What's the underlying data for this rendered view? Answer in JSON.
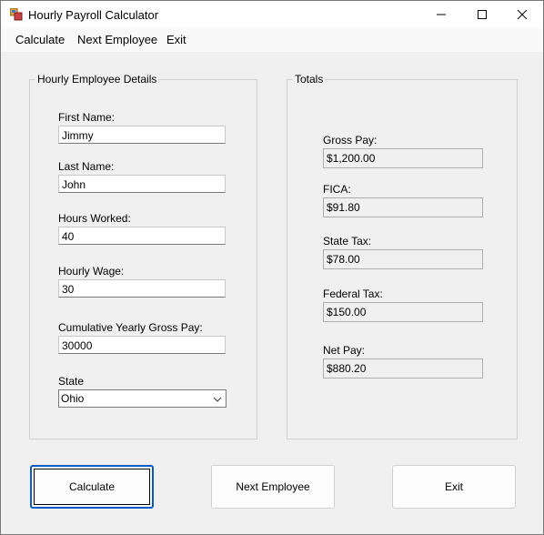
{
  "window": {
    "title": "Hourly Payroll Calculator"
  },
  "menu": {
    "items": [
      "Calculate",
      "Next Employee",
      "Exit"
    ]
  },
  "details": {
    "group_title": "Hourly Employee Details",
    "first_name_label": "First Name:",
    "first_name_value": "Jimmy",
    "last_name_label": "Last Name:",
    "last_name_value": "John",
    "hours_label": "Hours Worked:",
    "hours_value": "40",
    "wage_label": "Hourly Wage:",
    "wage_value": "30",
    "cumulative_label": "Cumulative Yearly Gross Pay:",
    "cumulative_value": "30000",
    "state_label": "State",
    "state_value": "Ohio"
  },
  "totals": {
    "group_title": "Totals",
    "gross_label": "Gross Pay:",
    "gross_value": "$1,200.00",
    "fica_label": "FICA:",
    "fica_value": "$91.80",
    "state_tax_label": "State Tax:",
    "state_tax_value": "$78.00",
    "federal_tax_label": "Federal Tax:",
    "federal_tax_value": "$150.00",
    "net_label": "Net Pay:",
    "net_value": "$880.20"
  },
  "buttons": {
    "calculate": "Calculate",
    "next_employee": "Next Employee",
    "exit": "Exit"
  },
  "icons": {
    "app": "app-icon",
    "minimize": "minimize-icon",
    "maximize": "maximize-icon",
    "close": "close-icon",
    "dropdown": "chevron-down-icon"
  },
  "colors": {
    "accent": "#0a5bc4",
    "window_bg": "#f0f0f0"
  }
}
